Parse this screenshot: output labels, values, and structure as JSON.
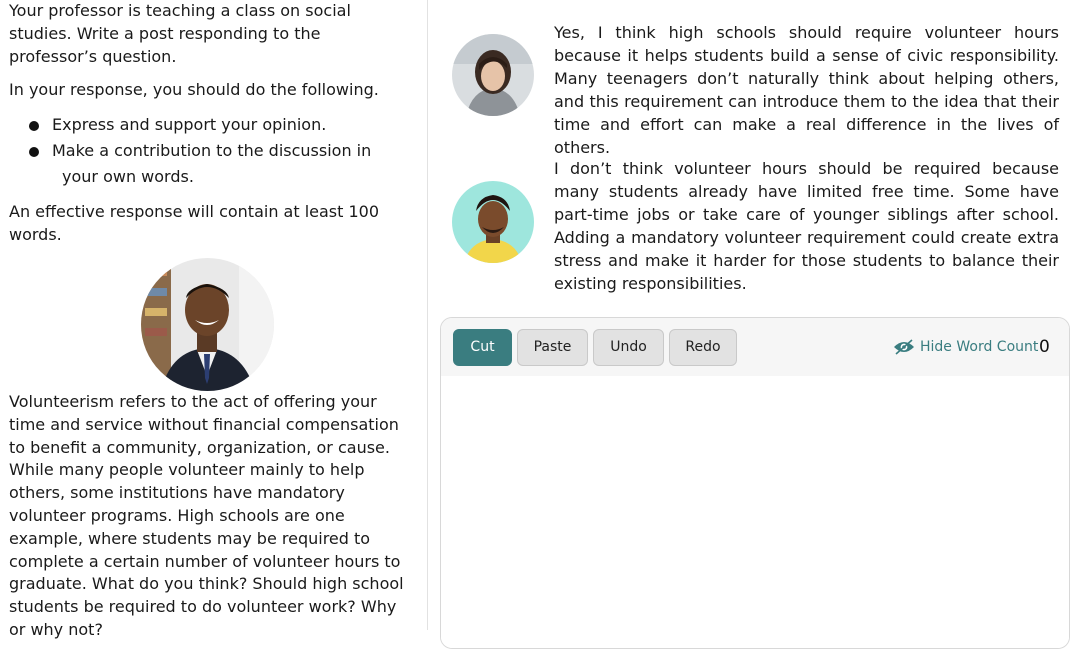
{
  "prompt": {
    "intro": "Your professor is teaching a class on social studies. Write a post responding to the professor’s question.",
    "instructions": "In your response, you should do the following.",
    "bullets": [
      "Express and support your opinion.",
      "Make a contribution to the discussion in",
      "your own words."
    ],
    "effective": "An effective response will contain at least 100 words."
  },
  "professor": {
    "question": "Volunteerism refers to the act of offering your time and service without financial compensation to benefit a community, organization, or cause. While many people volunteer mainly to help others, some institutions have mandatory volunteer programs. High schools are one example, where students may be required to complete a certain number of volunteer hours to graduate. What do you think? Should high school students be required to do volunteer work? Why or why not?"
  },
  "posts": [
    {
      "text": "Yes, I think high schools should require volunteer hours because it helps students build a sense of civic responsibility. Many teenagers don’t naturally think about helping others, and this requirement can introduce them to the idea that their time and effort can make a real difference in the lives of others."
    },
    {
      "text": "I don’t think volunteer hours should be required because many students already have limited free time. Some have part-time jobs or take care of younger siblings after school. Adding a mandatory volunteer requirement could create extra stress and make it harder for those students to balance their existing responsibilities."
    }
  ],
  "editor": {
    "cut_label": "Cut",
    "paste_label": "Paste",
    "undo_label": "Undo",
    "redo_label": "Redo",
    "hide_word_count_label": "Hide Word Count",
    "word_count": "0",
    "response_value": ""
  },
  "colors": {
    "accent": "#3a7d80",
    "button_gray": "#e2e2e2"
  },
  "icons": {
    "eye": "eye-icon",
    "bullet": "bullet-dot-icon"
  }
}
